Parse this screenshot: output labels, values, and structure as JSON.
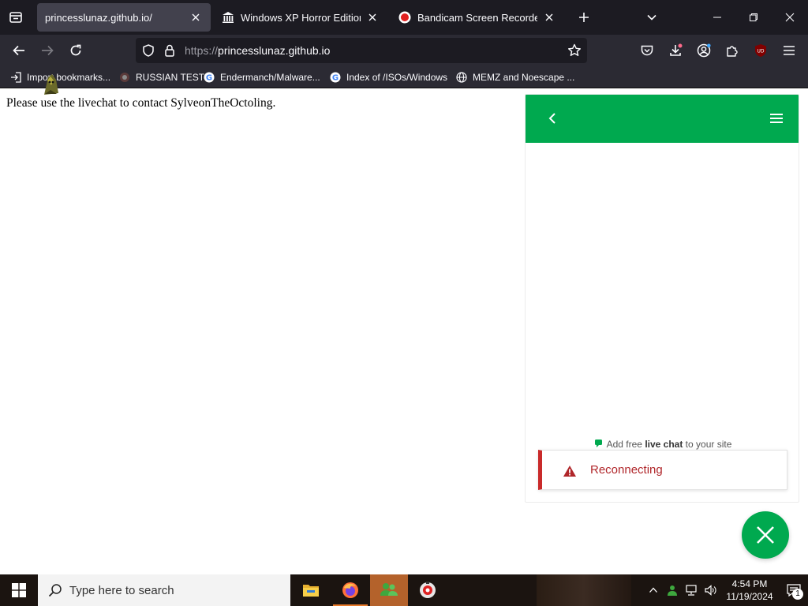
{
  "tabs": [
    {
      "title": "princesslunaz.github.io/",
      "icon": "blank-page-icon",
      "active": true
    },
    {
      "title": "Windows XP Horror Edition (De",
      "icon": "archive-building-icon",
      "active": false
    },
    {
      "title": "Bandicam Screen Recorder Dow",
      "icon": "record-dot-icon",
      "active": false
    }
  ],
  "navbar": {
    "url_scheme": "https://",
    "url_host": "princesslunaz.github.io"
  },
  "bookmarks": [
    {
      "label": "Import bookmarks...",
      "icon": "import-icon"
    },
    {
      "label": "RUSSIAN TEST",
      "icon": "site-favicon"
    },
    {
      "label": "Endermanch/Malware...",
      "icon": "google-icon"
    },
    {
      "label": "Index of /ISOs/Windows",
      "icon": "google-icon"
    },
    {
      "label": "MEMZ and Noescape ...",
      "icon": "globe-icon"
    }
  ],
  "page": {
    "message": "Please use the livechat to contact SylveonTheOctoling."
  },
  "chat": {
    "promo_prefix": "Add free ",
    "promo_bold": "live chat",
    "promo_suffix": " to your site",
    "status": "Reconnecting"
  },
  "taskbar": {
    "search_placeholder": "Type here to search",
    "apps": [
      "file-explorer-icon",
      "firefox-icon",
      "messenger-icon",
      "bandicam-icon"
    ],
    "time": "4:54 PM",
    "date": "11/19/2024",
    "notification_count": "1"
  },
  "colors": {
    "chat_green": "#00a94f",
    "error_red": "#c92a2a",
    "browser_dark": "#1c1b22",
    "browser_toolbar": "#2b2a33"
  }
}
